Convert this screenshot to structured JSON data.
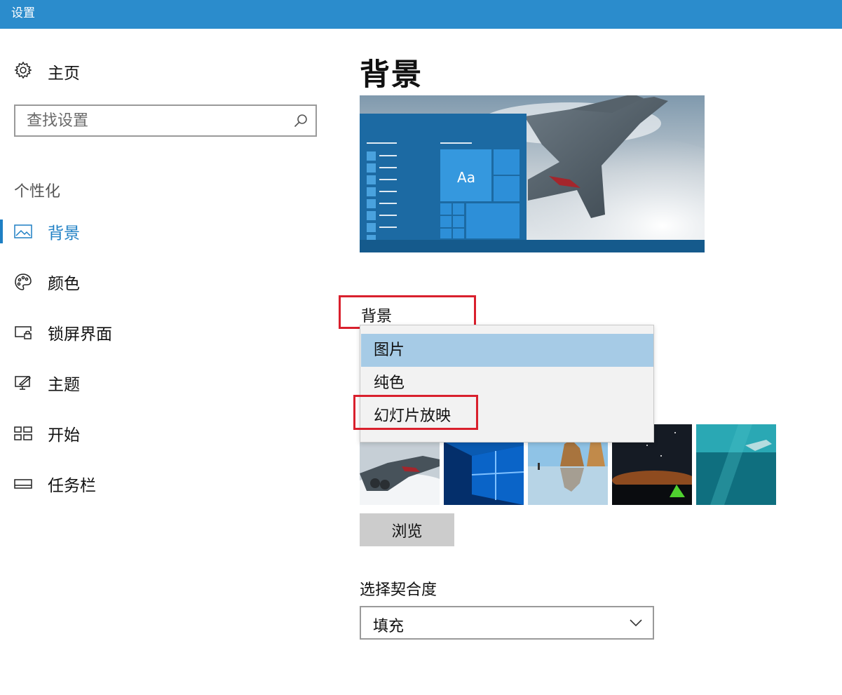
{
  "window": {
    "title": "设置"
  },
  "sidebar": {
    "home_label": "主页",
    "search_placeholder": "查找设置",
    "section_label": "个性化",
    "items": [
      {
        "label": "背景",
        "icon": "picture-icon",
        "active": true
      },
      {
        "label": "颜色",
        "icon": "palette-icon",
        "active": false
      },
      {
        "label": "锁屏界面",
        "icon": "lock-screen-icon",
        "active": false
      },
      {
        "label": "主题",
        "icon": "theme-icon",
        "active": false
      },
      {
        "label": "开始",
        "icon": "start-icon",
        "active": false
      },
      {
        "label": "任务栏",
        "icon": "taskbar-icon",
        "active": false
      }
    ]
  },
  "main": {
    "title": "背景",
    "preview": {
      "tile_text": "Aa"
    },
    "background_label": "背景",
    "background_options": [
      {
        "label": "图片",
        "selected": true
      },
      {
        "label": "纯色",
        "selected": false
      },
      {
        "label": "幻灯片放映",
        "selected": false
      }
    ],
    "browse_label": "浏览",
    "fit_label": "选择契合度",
    "fit_value": "填充"
  },
  "colors": {
    "titlebar": "#2b8ccc",
    "accent": "#1e7fc4",
    "selected_option": "#a6cbe6",
    "highlight_box": "#d9202d"
  }
}
